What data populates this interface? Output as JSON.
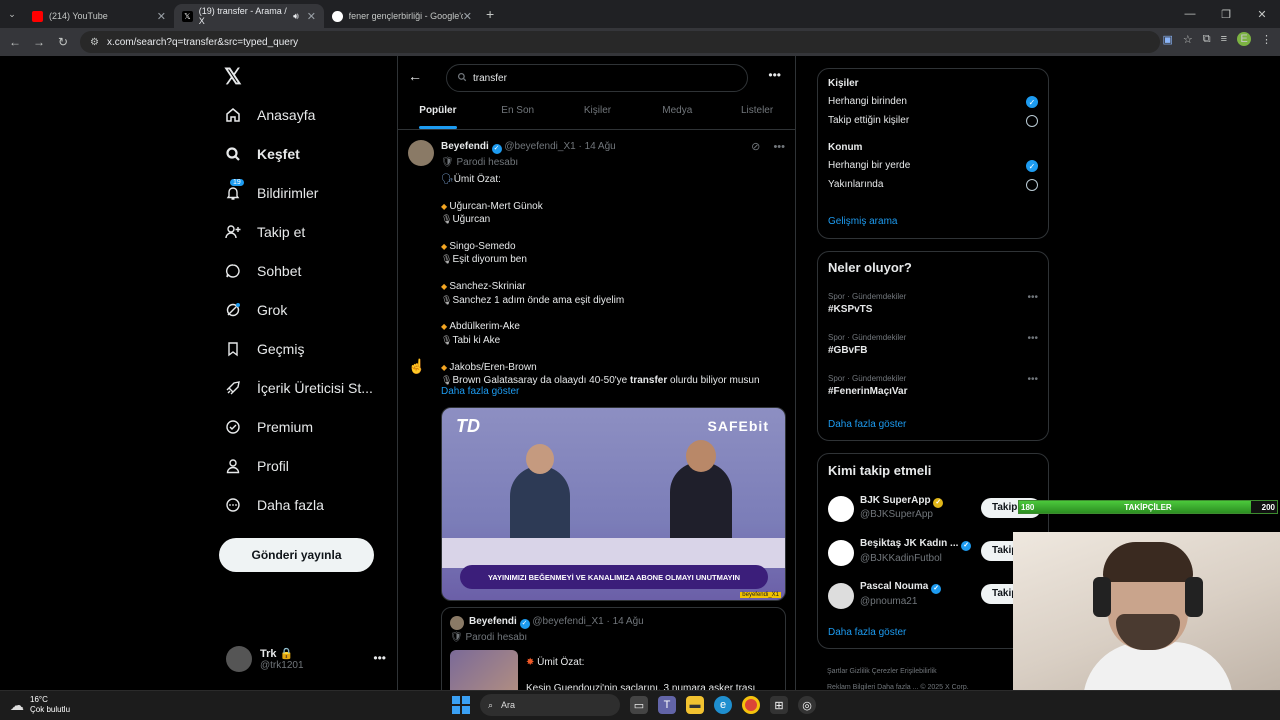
{
  "browser": {
    "tabs": [
      {
        "label": "(214) YouTube",
        "color": "#ff0000",
        "active": false
      },
      {
        "label": "(19) transfer - Arama / X",
        "color": "#ffffff",
        "active": true
      },
      {
        "label": "fener gençlerbirliği - Google'da",
        "color": "#4285f4",
        "active": false
      }
    ],
    "url": "x.com/search?q=transfer&src=typed_query",
    "profile_initial": "E"
  },
  "sidebar": {
    "logo": "𝕏",
    "items": [
      {
        "label": "Anasayfa",
        "icon": "home-icon",
        "bold": false
      },
      {
        "label": "Keşfet",
        "icon": "search-icon",
        "bold": true
      },
      {
        "label": "Bildirimler",
        "icon": "bell-icon",
        "bold": false,
        "badge": "19"
      },
      {
        "label": "Takip et",
        "icon": "follow-icon",
        "bold": false
      },
      {
        "label": "Sohbet",
        "icon": "chat-icon",
        "bold": false
      },
      {
        "label": "Grok",
        "icon": "grok-icon",
        "bold": false
      },
      {
        "label": "Geçmiş",
        "icon": "bookmark-icon",
        "bold": false
      },
      {
        "label": "İçerik Üreticisi St...",
        "icon": "rocket-icon",
        "bold": false
      },
      {
        "label": "Premium",
        "icon": "premium-icon",
        "bold": false
      },
      {
        "label": "Profil",
        "icon": "profile-icon",
        "bold": false
      },
      {
        "label": "Daha fazla",
        "icon": "more-icon",
        "bold": false
      }
    ],
    "post_button": "Gönderi yayınla",
    "account": {
      "name": "Trk 🔒",
      "handle": "@trk1201"
    }
  },
  "search": {
    "query": "transfer",
    "tabs": [
      "Popüler",
      "En Son",
      "Kişiler",
      "Medya",
      "Listeler"
    ],
    "active_tab": "Popüler"
  },
  "tweet": {
    "name": "Beyefendi",
    "handle": "@beyefendi_X1",
    "date": "· 14 Ağu",
    "parody": "Parodi hesabı",
    "intro": "Ümit Özat:",
    "pairs": [
      {
        "players": "Uğurcan-Mert Günok",
        "answer": "Uğurcan"
      },
      {
        "players": "Singo-Semedo",
        "answer": "Eşit diyorum ben"
      },
      {
        "players": "Sanchez-Skriniar",
        "answer": "Sanchez 1 adım önde ama eşit diyelim"
      },
      {
        "players": "Abdülkerim-Ake",
        "answer": "Tabi ki Ake"
      },
      {
        "players": "Jakobs/Eren-Brown",
        "answer_pre": "Brown Galatasaray da olaaydı 40-50'ye ",
        "answer_bold": "transfer",
        "answer_post": " olurdu biliyor musun"
      }
    ],
    "show_more": "Daha fazla göster",
    "media": {
      "logo_left": "TD",
      "logo_right": "SAFEbit",
      "banner": "YAYINIMIZI BEĞENMEYİ VE KANALIMIZA ABONE OLMAYI UNUTMAYIN",
      "watermark": "beyefendi_X1"
    },
    "quote": {
      "name": "Beyefendi",
      "handle": "@beyefendi_X1",
      "date": "· 14 Ağu",
      "parody": "Parodi hesabı",
      "intro": "Ümit Özat:",
      "text": "Kesin Guendouzi'nin saçlarını, 3 numara asker traşı"
    }
  },
  "filters": {
    "people_title": "Kişiler",
    "people_options": [
      {
        "label": "Herhangi birinden",
        "selected": true
      },
      {
        "label": "Takip ettiğin kişiler",
        "selected": false
      }
    ],
    "location_title": "Konum",
    "location_options": [
      {
        "label": "Herhangi bir yerde",
        "selected": true
      },
      {
        "label": "Yakınlarında",
        "selected": false
      }
    ],
    "advanced": "Gelişmiş arama"
  },
  "trends": {
    "title": "Neler oluyor?",
    "items": [
      {
        "category": "Spor · Gündemdekiler",
        "tag": "#KSPvTS"
      },
      {
        "category": "Spor · Gündemdekiler",
        "tag": "#GBvFB"
      },
      {
        "category": "Spor · Gündemdekiler",
        "tag": "#FenerinMaçıVar"
      }
    ],
    "show_more": "Daha fazla göster"
  },
  "who_to_follow": {
    "title": "Kimi takip etmeli",
    "items": [
      {
        "name": "BJK SuperApp",
        "handle": "@BJKSuperApp",
        "button": "Takip et"
      },
      {
        "name": "Beşiktaş JK Kadın ...",
        "handle": "@BJKKadinFutbol",
        "button": "Takip et"
      },
      {
        "name": "Pascal Nouma",
        "handle": "@pnouma21",
        "button": "Takip et"
      }
    ],
    "show_more": "Daha fazla göster"
  },
  "footer": {
    "line1": "Şartlar   Gizlilik   Çerezler   Erişilebilirlik",
    "line2": "Reklam Bilgileri   Daha fazla ...   © 2025 X Corp."
  },
  "overlay": {
    "bar_left": "180",
    "bar_center": "TAKİPÇİLER",
    "bar_right": "200",
    "progress": 0.9
  },
  "taskbar": {
    "temperature": "16°C",
    "weather": "Çok bulutlu",
    "search": "Ara"
  }
}
